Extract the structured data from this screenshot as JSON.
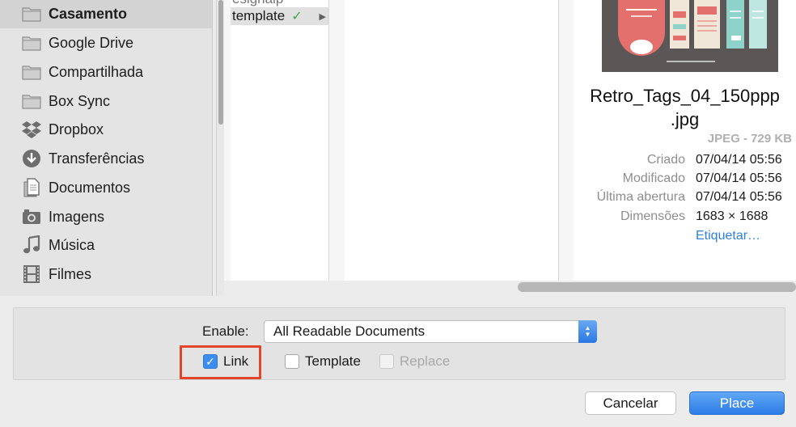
{
  "sidebar": {
    "items": [
      {
        "label": "Casamento",
        "icon": "folder-icon",
        "selected": true
      },
      {
        "label": "Google Drive",
        "icon": "folder-icon"
      },
      {
        "label": "Compartilhada",
        "icon": "folder-icon"
      },
      {
        "label": "Box Sync",
        "icon": "folder-icon"
      },
      {
        "label": "Dropbox",
        "icon": "dropbox-icon"
      },
      {
        "label": "Transferências",
        "icon": "download-icon"
      },
      {
        "label": "Documentos",
        "icon": "documents-icon"
      },
      {
        "label": "Imagens",
        "icon": "camera-icon"
      },
      {
        "label": "Música",
        "icon": "music-icon"
      },
      {
        "label": "Filmes",
        "icon": "film-icon"
      }
    ]
  },
  "browser": {
    "column1": {
      "partial_item": "esignalp",
      "selected_item": "template",
      "selected_check": "✓"
    }
  },
  "preview": {
    "file_name_line1": "Retro_Tags_04_150ppp",
    "file_name_line2": ".jpg",
    "file_type": "JPEG - 729 KB",
    "meta": [
      {
        "key": "Criado",
        "value": "07/04/14 05:56"
      },
      {
        "key": "Modificado",
        "value": "07/04/14 05:56"
      },
      {
        "key": "Última abertura",
        "value": "07/04/14 05:56"
      },
      {
        "key": "Dimensões",
        "value": "1683 × 1688"
      }
    ],
    "tag_link": "Etiquetar…"
  },
  "options": {
    "enable_label": "Enable:",
    "enable_value": "All Readable Documents",
    "checkboxes": [
      {
        "label": "Link",
        "checked": true,
        "disabled": false
      },
      {
        "label": "Template",
        "checked": false,
        "disabled": false
      },
      {
        "label": "Replace",
        "checked": false,
        "disabled": true
      }
    ]
  },
  "buttons": {
    "cancel": "Cancelar",
    "place": "Place"
  },
  "colors": {
    "accent": "#3b8ef0",
    "highlight": "#e2452a",
    "link": "#2e80d8",
    "check": "#3da74e"
  }
}
